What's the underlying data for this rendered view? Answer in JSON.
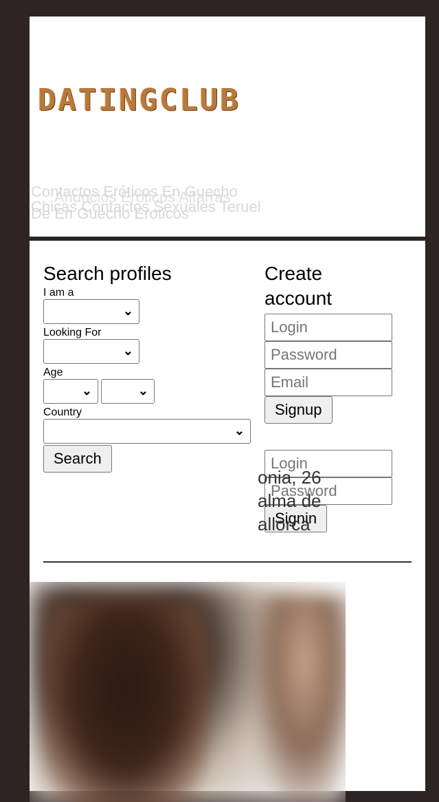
{
  "header": {
    "logo": "DATINGCLUB",
    "tagline_lines": [
      "Contactos Eróticos En Guecho",
      "Chicas Contactos Sexuales Teruel",
      "De En Guecho Eroticos"
    ],
    "tagline_overlay": "Anuncios Eróticos Alfarràs"
  },
  "search": {
    "title": "Search profiles",
    "iam_label": "I am a",
    "looking_label": "Looking For",
    "age_label": "Age",
    "country_label": "Country",
    "button": "Search"
  },
  "signup": {
    "title_line1": "Create",
    "title_line2": "account",
    "login_placeholder": "Login",
    "password_placeholder": "Password",
    "email_placeholder": "Email",
    "button": "Signup"
  },
  "signin": {
    "login_placeholder": "Login",
    "password_placeholder": "Password",
    "button": "Signin"
  },
  "profile": {
    "line1": "onia, 26",
    "line2": "alma de",
    "line3": "allorca"
  }
}
